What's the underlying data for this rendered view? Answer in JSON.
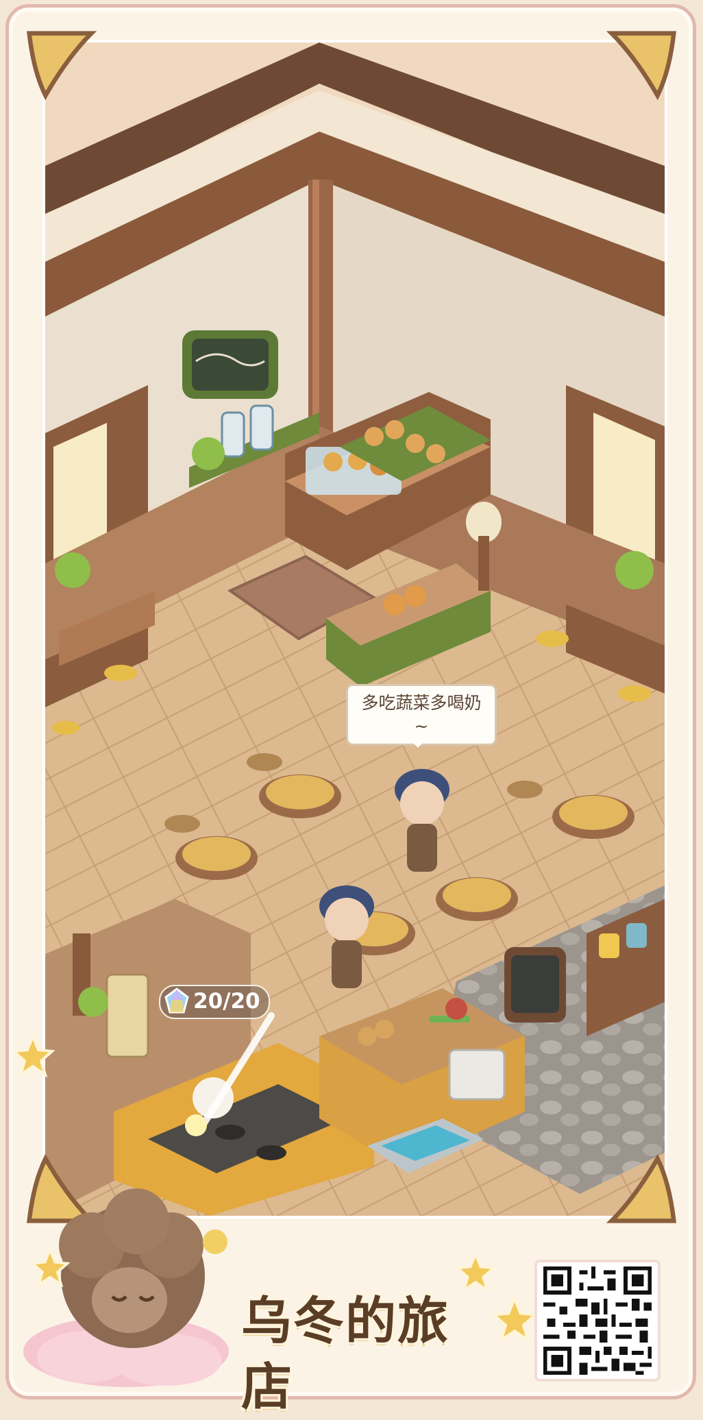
{
  "game": {
    "logo_text": "乌冬的旅店"
  },
  "hud": {
    "energy_value": "20/20",
    "energy_icon": "crystal-icon"
  },
  "npc": {
    "speech_text": "多吃蔬菜多喝奶~"
  },
  "colors": {
    "frame_border": "#e2b8ae",
    "frame_bg": "#fbf3e6",
    "wall": "#eadbc8",
    "wood_dark": "#7a4f35",
    "floor": "#d9b68c",
    "accent_yellow": "#f4cf68"
  }
}
